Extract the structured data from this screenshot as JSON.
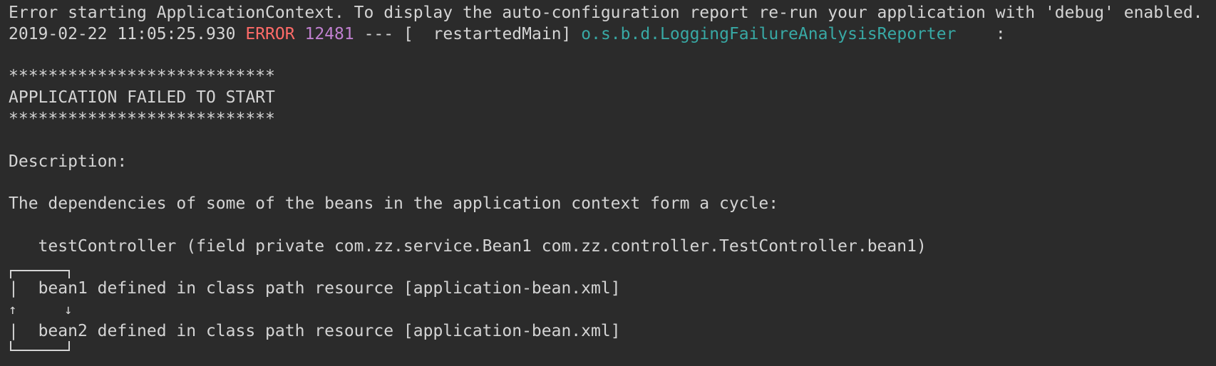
{
  "console": {
    "line1": "Error starting ApplicationContext. To display the auto-configuration report re-run your application with 'debug' enabled.",
    "log": {
      "timestamp": "2019-02-22 11:05:25.930",
      "level": "ERROR",
      "pid": "12481",
      "separator": "---",
      "thread": "[  restartedMain]",
      "logger": "o.s.b.d.LoggingFailureAnalysisReporter",
      "colon": ":"
    },
    "stars_top": "***************************",
    "banner": "APPLICATION FAILED TO START",
    "stars_bottom": "***************************",
    "description_label": "Description:",
    "description_text": "The dependencies of some of the beans in the application context form a cycle:",
    "controller_line": "testController (field private com.zz.service.Bean1 com.zz.controller.TestController.bean1)",
    "bean1_line": "bean1 defined in class path resource [application-bean.xml]",
    "bean2_line": "bean2 defined in class path resource [application-bean.xml]",
    "pipe": "|",
    "arrow_up": "↑",
    "arrow_down": "↓"
  },
  "colors": {
    "background": "#2b2b2b",
    "text": "#d4d4d4",
    "error": "#ff6b68",
    "pid": "#c080d0",
    "logger": "#38a9a5"
  }
}
